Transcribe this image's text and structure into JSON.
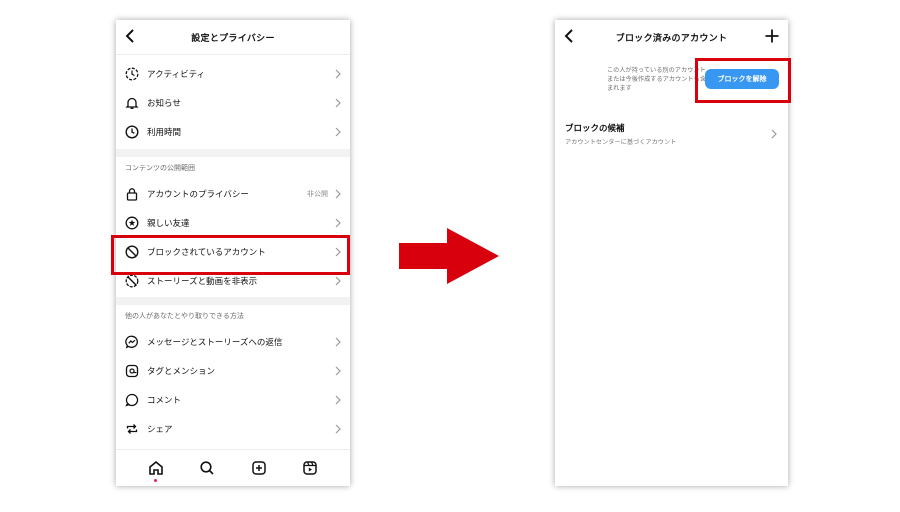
{
  "left_screen": {
    "title": "設定とプライバシー",
    "rows_group1": [
      {
        "label": "アクティビティ",
        "icon": "activity-icon"
      },
      {
        "label": "お知らせ",
        "icon": "bell-icon"
      },
      {
        "label": "利用時間",
        "icon": "clock-icon"
      }
    ],
    "section_visibility": "コンテンツの公開範囲",
    "rows_group2": [
      {
        "label": "アカウントのプライバシー",
        "meta": "非公開",
        "icon": "lock-icon"
      },
      {
        "label": "親しい友達",
        "icon": "star-icon"
      },
      {
        "label": "ブロックされているアカウント",
        "icon": "block-icon"
      },
      {
        "label": "ストーリーズと動画を非表示",
        "icon": "hide-icon"
      }
    ],
    "section_interaction": "他の人があなたとやり取りできる方法",
    "rows_group3": [
      {
        "label": "メッセージとストーリーズへの返信",
        "icon": "messenger-icon"
      },
      {
        "label": "タグとメンション",
        "icon": "mention-icon"
      },
      {
        "label": "コメント",
        "icon": "comment-icon"
      },
      {
        "label": "シェア",
        "icon": "share-icon"
      }
    ]
  },
  "right_screen": {
    "title": "ブロック済みのアカウント",
    "info_text": "この人が持っている別のアカウントまたは今後作成するアカウントも含まれます",
    "unblock_button": "ブロックを解除",
    "suggestion_title": "ブロックの候補",
    "suggestion_subtitle": "アカウントセンターに基づくアカウント"
  },
  "colors": {
    "highlight": "#d9000d",
    "button_blue": "#3897f0"
  }
}
